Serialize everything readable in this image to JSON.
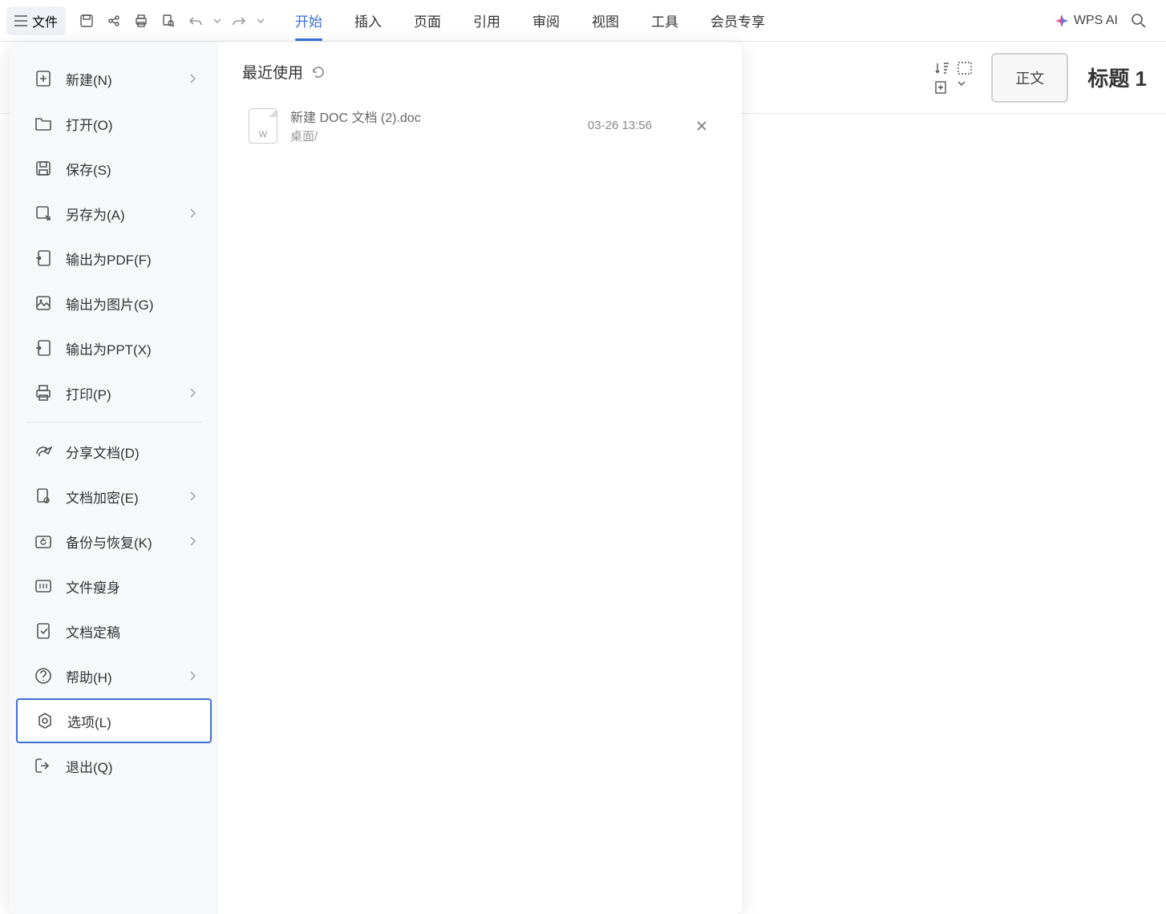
{
  "toolbar": {
    "file_label": "文件",
    "tabs": [
      "开始",
      "插入",
      "页面",
      "引用",
      "审阅",
      "视图",
      "工具",
      "会员专享"
    ],
    "active_tab_index": 0,
    "wps_ai_label": "WPS AI"
  },
  "ribbon": {
    "style_normal": "正文",
    "style_heading": "标题 1"
  },
  "file_menu": {
    "items": [
      {
        "label": "新建(N)",
        "has_submenu": true
      },
      {
        "label": "打开(O)",
        "has_submenu": false
      },
      {
        "label": "保存(S)",
        "has_submenu": false
      },
      {
        "label": "另存为(A)",
        "has_submenu": true
      },
      {
        "label": "输出为PDF(F)",
        "has_submenu": false
      },
      {
        "label": "输出为图片(G)",
        "has_submenu": false
      },
      {
        "label": "输出为PPT(X)",
        "has_submenu": false
      },
      {
        "label": "打印(P)",
        "has_submenu": true,
        "divider_after": true
      },
      {
        "label": "分享文档(D)",
        "has_submenu": false
      },
      {
        "label": "文档加密(E)",
        "has_submenu": true
      },
      {
        "label": "备份与恢复(K)",
        "has_submenu": true
      },
      {
        "label": "文件瘦身",
        "has_submenu": false
      },
      {
        "label": "文档定稿",
        "has_submenu": false
      },
      {
        "label": "帮助(H)",
        "has_submenu": true
      },
      {
        "label": "选项(L)",
        "has_submenu": false,
        "selected": true
      },
      {
        "label": "退出(Q)",
        "has_submenu": false
      }
    ]
  },
  "recent": {
    "header": "最近使用",
    "items": [
      {
        "name": "新建 DOC 文档 (2).doc",
        "path": "桌面/",
        "time": "03-26 13:56"
      }
    ]
  }
}
